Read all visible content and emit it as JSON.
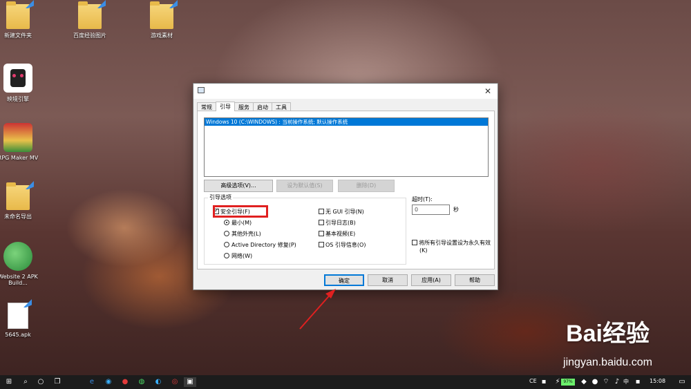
{
  "desktop": {
    "icons": [
      {
        "label": "新建文件夹"
      },
      {
        "label": "百度经验图片"
      },
      {
        "label": "游戏素材"
      },
      {
        "label": "映境引擎"
      },
      {
        "label": "RPG Maker MV"
      },
      {
        "label": "未命名导出"
      },
      {
        "label": "Website 2 APK Build..."
      },
      {
        "label": "5645.apk"
      }
    ]
  },
  "dialog": {
    "close_glyph": "✕",
    "tabs": [
      "常规",
      "引导",
      "服务",
      "启动",
      "工具"
    ],
    "active_tab": "引导",
    "os_entries": [
      "Windows 10 (C:\\WINDOWS) : 当前操作系统; 默认操作系统"
    ],
    "buttons": {
      "advanced": "高级选项(V)...",
      "set_default": "设为默认值(S)",
      "delete": "删除(D)"
    },
    "boot_options": {
      "label": "引导选项",
      "safe_boot": "安全引导(F)",
      "minimal": "最小(M)",
      "alternate_shell": "其他外壳(L)",
      "ad_repair": "Active Directory 修复(P)",
      "network": "网络(W)",
      "no_gui": "无 GUI 引导(N)",
      "boot_log": "引导日志(B)",
      "base_video": "基本视频(E)",
      "os_boot_info": "OS 引导信息(O)"
    },
    "timeout": {
      "label": "超时(T):",
      "value": "0",
      "unit": "秒"
    },
    "make_permanent": "将所有引导设置设为永久有效",
    "make_permanent_key": "(K)",
    "footer": {
      "ok": "确定",
      "cancel": "取消",
      "apply": "应用(A)",
      "help": "帮助"
    }
  },
  "taskbar": {
    "battery": "97%",
    "ime": "中",
    "time": "15:08",
    "tray_lang": "CE"
  },
  "watermark": {
    "brand": "Bai经验",
    "url": "jingyan.baidu.com"
  },
  "colors": {
    "selection": "#0078d7",
    "highlight_box": "#e02020",
    "arrow": "#e02020"
  }
}
